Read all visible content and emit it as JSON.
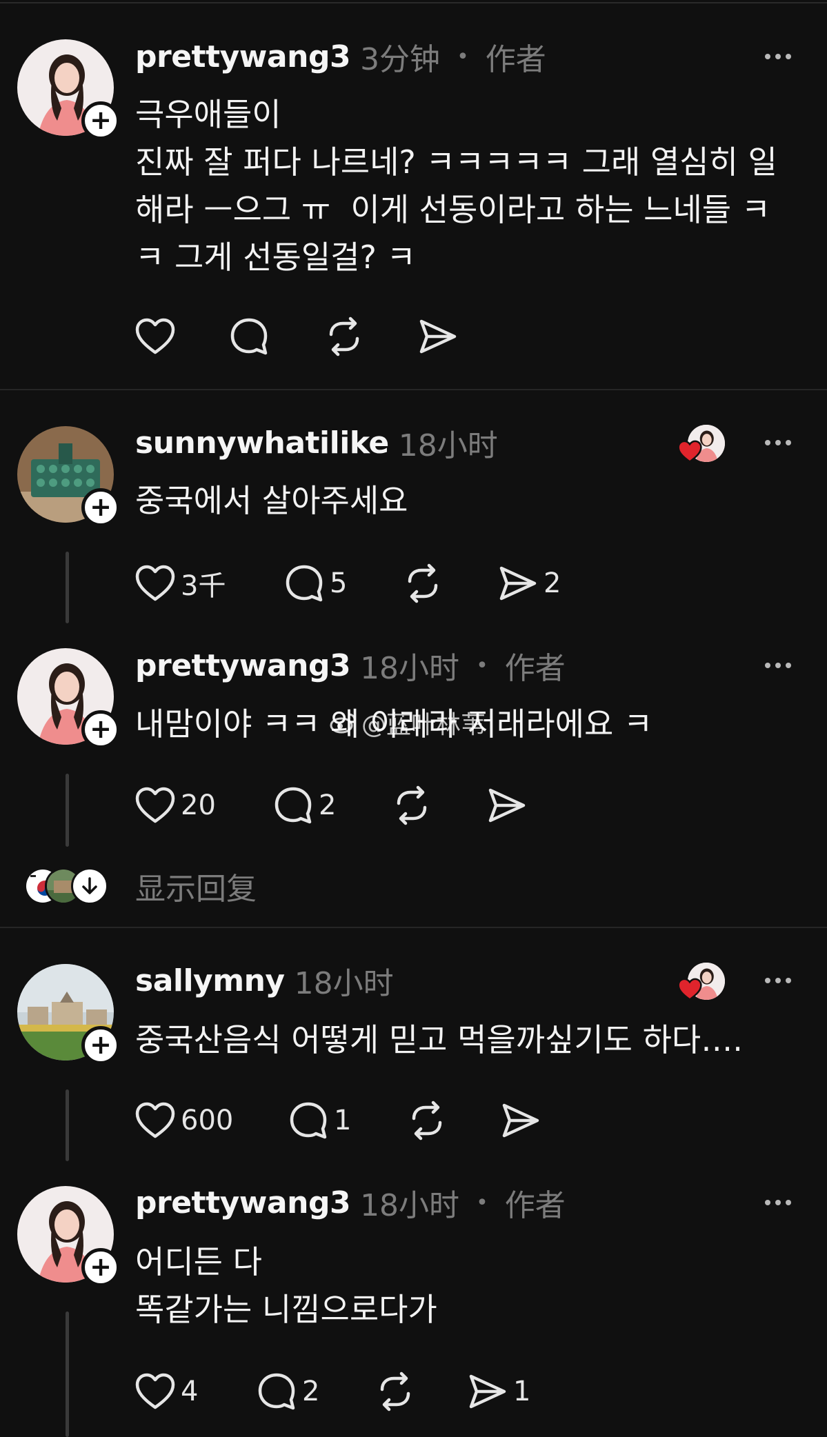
{
  "posts": [
    {
      "username": "prettywang3",
      "time": "3分钟",
      "role": "作者",
      "text": "극우애들이\n진짜 잘 퍼다 나르네? ㅋㅋㅋㅋㅋ 그래 열심히 일해라 ㅡ으그 ㅠ  이게 선동이라고 하는 느네들 ㅋㅋ 그게 선동일걸? ㅋ",
      "likes": "",
      "replies": "",
      "reposts": "",
      "shares": ""
    },
    {
      "username": "sunnywhatilike",
      "time": "18小时",
      "role": "",
      "text": "중국에서 살아주세요",
      "likes": "3千",
      "replies": "5",
      "reposts": "",
      "shares": "2"
    },
    {
      "username": "prettywang3",
      "time": "18小时",
      "role": "作者",
      "text": "내맘이야 ㅋㅋ 왜 이래라 저래라에요 ㅋ",
      "likes": "20",
      "replies": "2",
      "reposts": "",
      "shares": ""
    },
    {
      "username": "sallymny",
      "time": "18小时",
      "role": "",
      "text": "중국산음식 어떻게 믿고 먹을까싶기도 하다….",
      "likes": "600",
      "replies": "1",
      "reposts": "",
      "shares": ""
    },
    {
      "username": "prettywang3",
      "time": "18小时",
      "role": "作者",
      "text": "어디든 다\n똑같가는 니낌으로다가",
      "likes": "4",
      "replies": "2",
      "reposts": "",
      "shares": "1"
    }
  ],
  "show_replies_label": "显示回复",
  "watermark": "@蓝叶林苇",
  "icons": {
    "like": "heart-icon",
    "reply": "comment-bubble-icon",
    "repost": "repost-icon",
    "share": "send-icon",
    "more": "more-dots-icon",
    "follow": "plus-icon",
    "show": "arrow-down-icon"
  },
  "colors": {
    "background": "#101010",
    "text": "#f3f3f3",
    "muted": "#7c7c7c",
    "liked_heart": "#e0242c"
  }
}
